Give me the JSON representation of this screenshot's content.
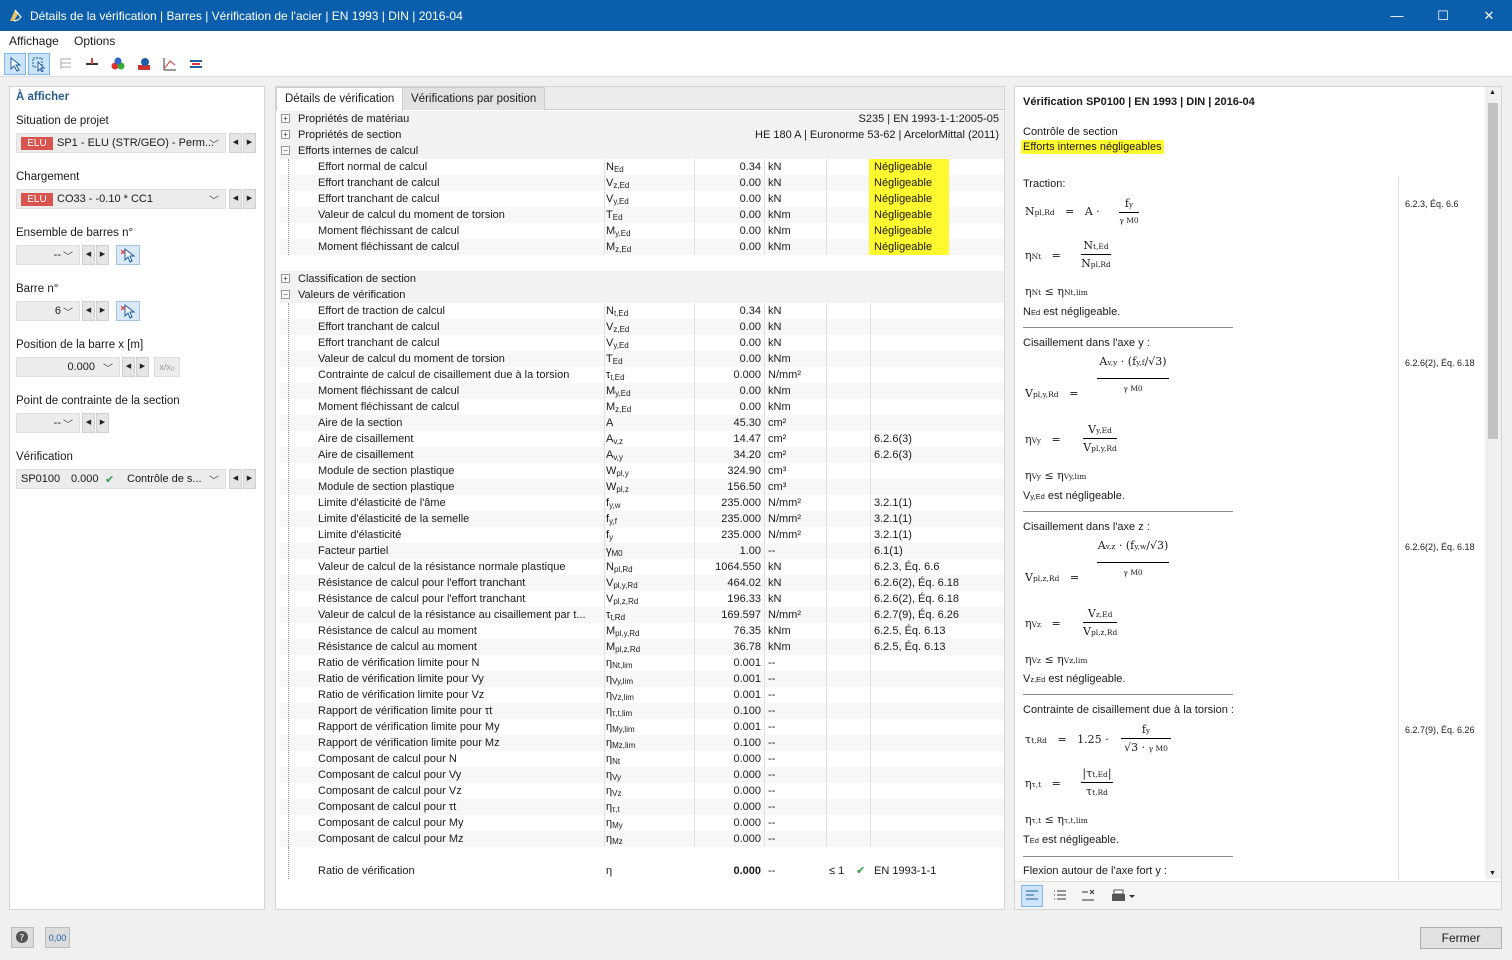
{
  "window": {
    "title": "Détails de la vérification | Barres | Vérification de l'acier | EN 1993 | DIN | 2016-04",
    "minimize": "—",
    "maximize": "☐",
    "close": "✕"
  },
  "menu": {
    "affichage": "Affichage",
    "options": "Options"
  },
  "left": {
    "header": "À afficher",
    "situation_label": "Situation de projet",
    "situation_badge": "ELU",
    "situation_value": "SP1 - ELU (STR/GEO) - Perm...",
    "chargement_label": "Chargement",
    "chargement_badge": "ELU",
    "chargement_value": "CO33 - -0.10 * CC1",
    "ensemble_label": "Ensemble de barres n°",
    "ensemble_value": "--",
    "barre_label": "Barre n°",
    "barre_value": "6",
    "position_label": "Position de la barre x [m]",
    "position_value": "0.000",
    "position_btn": "x/x₀",
    "point_label": "Point de contrainte de la section",
    "point_value": "--",
    "verif_label": "Vérification",
    "verif_id": "SP0100",
    "verif_ratio": "0.000",
    "verif_type": "Contrôle de s...",
    "left_arrow": "◀",
    "right_arrow": "▶"
  },
  "tabs": {
    "details": "Détails de vérification",
    "par_position": "Vérifications par position"
  },
  "groups": {
    "materiau": {
      "label": "Propriétés de matériau",
      "value": "S235 | EN 1993-1-1:2005-05"
    },
    "section": {
      "label": "Propriétés de section",
      "value": "HE 180 A | Euronorme 53-62 | ArcelorMittal (2011)"
    },
    "efforts": {
      "label": "Efforts internes de calcul"
    },
    "classification": {
      "label": "Classification de section"
    },
    "valeurs": {
      "label": "Valeurs de vérification"
    }
  },
  "efforts_rows": [
    {
      "name": "Effort normal de calcul",
      "sym": "NEd",
      "val": "0.34",
      "unit": "kN",
      "ref": "Négligeable"
    },
    {
      "name": "Effort tranchant de calcul",
      "sym": "Vz,Ed",
      "val": "0.00",
      "unit": "kN",
      "ref": "Négligeable"
    },
    {
      "name": "Effort tranchant de calcul",
      "sym": "Vy,Ed",
      "val": "0.00",
      "unit": "kN",
      "ref": "Négligeable"
    },
    {
      "name": "Valeur de calcul du moment de torsion",
      "sym": "TEd",
      "val": "0.00",
      "unit": "kNm",
      "ref": "Négligeable"
    },
    {
      "name": "Moment fléchissant de calcul",
      "sym": "My,Ed",
      "val": "0.00",
      "unit": "kNm",
      "ref": "Négligeable"
    },
    {
      "name": "Moment fléchissant de calcul",
      "sym": "Mz,Ed",
      "val": "0.00",
      "unit": "kNm",
      "ref": "Négligeable"
    }
  ],
  "valeurs_rows": [
    {
      "name": "Effort de traction de calcul",
      "sym": "Nt,Ed",
      "val": "0.34",
      "unit": "kN",
      "ref": ""
    },
    {
      "name": "Effort tranchant de calcul",
      "sym": "Vz,Ed",
      "val": "0.00",
      "unit": "kN",
      "ref": ""
    },
    {
      "name": "Effort tranchant de calcul",
      "sym": "Vy,Ed",
      "val": "0.00",
      "unit": "kN",
      "ref": ""
    },
    {
      "name": "Valeur de calcul du moment de torsion",
      "sym": "TEd",
      "val": "0.00",
      "unit": "kNm",
      "ref": ""
    },
    {
      "name": "Contrainte de calcul de cisaillement due à la torsion",
      "sym": "τt,Ed",
      "val": "0.000",
      "unit": "N/mm²",
      "ref": ""
    },
    {
      "name": "Moment fléchissant de calcul",
      "sym": "My,Ed",
      "val": "0.00",
      "unit": "kNm",
      "ref": ""
    },
    {
      "name": "Moment fléchissant de calcul",
      "sym": "Mz,Ed",
      "val": "0.00",
      "unit": "kNm",
      "ref": ""
    },
    {
      "name": "Aire de la section",
      "sym": "A",
      "val": "45.30",
      "unit": "cm²",
      "ref": ""
    },
    {
      "name": "Aire de cisaillement",
      "sym": "Av,z",
      "val": "14.47",
      "unit": "cm²",
      "ref": "6.2.6(3)"
    },
    {
      "name": "Aire de cisaillement",
      "sym": "Av,y",
      "val": "34.20",
      "unit": "cm²",
      "ref": "6.2.6(3)"
    },
    {
      "name": "Module de section plastique",
      "sym": "Wpl,y",
      "val": "324.90",
      "unit": "cm³",
      "ref": ""
    },
    {
      "name": "Module de section plastique",
      "sym": "Wpl,z",
      "val": "156.50",
      "unit": "cm³",
      "ref": ""
    },
    {
      "name": "Limite d'élasticité de l'âme",
      "sym": "fy,w",
      "val": "235.000",
      "unit": "N/mm²",
      "ref": "3.2.1(1)"
    },
    {
      "name": "Limite d'élasticité de la semelle",
      "sym": "fy,f",
      "val": "235.000",
      "unit": "N/mm²",
      "ref": "3.2.1(1)"
    },
    {
      "name": "Limite d'élasticité",
      "sym": "fy",
      "val": "235.000",
      "unit": "N/mm²",
      "ref": "3.2.1(1)"
    },
    {
      "name": "Facteur partiel",
      "sym": "γM0",
      "val": "1.00",
      "unit": "--",
      "ref": "6.1(1)"
    },
    {
      "name": "Valeur de calcul de la résistance normale plastique",
      "sym": "Npl,Rd",
      "val": "1064.550",
      "unit": "kN",
      "ref": "6.2.3, Éq. 6.6"
    },
    {
      "name": "Résistance de calcul pour l'effort tranchant",
      "sym": "Vpl,y,Rd",
      "val": "464.02",
      "unit": "kN",
      "ref": "6.2.6(2), Éq. 6.18"
    },
    {
      "name": "Résistance de calcul pour l'effort tranchant",
      "sym": "Vpl,z,Rd",
      "val": "196.33",
      "unit": "kN",
      "ref": "6.2.6(2), Éq. 6.18"
    },
    {
      "name": "Valeur de calcul de la résistance au cisaillement par t...",
      "sym": "τt,Rd",
      "val": "169.597",
      "unit": "N/mm²",
      "ref": "6.2.7(9), Éq. 6.26"
    },
    {
      "name": "Résistance de calcul au moment",
      "sym": "Mpl,y,Rd",
      "val": "76.35",
      "unit": "kNm",
      "ref": "6.2.5, Éq. 6.13"
    },
    {
      "name": "Résistance de calcul au moment",
      "sym": "Mpl,z,Rd",
      "val": "36.78",
      "unit": "kNm",
      "ref": "6.2.5, Éq. 6.13"
    },
    {
      "name": "Ratio de vérification limite pour N",
      "sym": "ηNt,lim",
      "val": "0.001",
      "unit": "--",
      "ref": ""
    },
    {
      "name": "Ratio de vérification limite pour Vy",
      "sym": "ηVy,lim",
      "val": "0.001",
      "unit": "--",
      "ref": ""
    },
    {
      "name": "Ratio de vérification limite pour Vz",
      "sym": "ηVz,lim",
      "val": "0.001",
      "unit": "--",
      "ref": ""
    },
    {
      "name": "Rapport de vérification limite pour τt",
      "sym": "ητ,t,lim",
      "val": "0.100",
      "unit": "--",
      "ref": ""
    },
    {
      "name": "Rapport de vérification limite pour My",
      "sym": "ηMy,lim",
      "val": "0.001",
      "unit": "--",
      "ref": ""
    },
    {
      "name": "Rapport de vérification limite pour Mz",
      "sym": "ηMz,lim",
      "val": "0.100",
      "unit": "--",
      "ref": ""
    },
    {
      "name": "Composant de calcul pour N",
      "sym": "ηNt",
      "val": "0.000",
      "unit": "--",
      "ref": ""
    },
    {
      "name": "Composant de calcul pour Vy",
      "sym": "ηVy",
      "val": "0.000",
      "unit": "--",
      "ref": ""
    },
    {
      "name": "Composant de calcul pour Vz",
      "sym": "ηVz",
      "val": "0.000",
      "unit": "--",
      "ref": ""
    },
    {
      "name": "Composant de calcul pour τt",
      "sym": "ητ,t",
      "val": "0.000",
      "unit": "--",
      "ref": ""
    },
    {
      "name": "Composant de calcul pour My",
      "sym": "ηMy",
      "val": "0.000",
      "unit": "--",
      "ref": ""
    },
    {
      "name": "Composant de calcul pour Mz",
      "sym": "ηMz",
      "val": "0.000",
      "unit": "--",
      "ref": ""
    }
  ],
  "ratio_row": {
    "name": "Ratio de vérification",
    "sym": "η",
    "val": "0.000",
    "unit": "--",
    "le": "≤ 1",
    "ck": "✔",
    "ref": "EN 1993-1-1"
  },
  "right": {
    "title": "Vérification SP0100 | EN 1993 | DIN | 2016-04",
    "controle": "Contrôle de section",
    "efforts_neg": "Efforts internes négligeables",
    "traction": "Traction:",
    "traction_ref": "6.2.3, Éq. 6.6",
    "ned_neg": "est négligeable.",
    "cis_y": "Cisaillement dans l'axe y :",
    "cis_y_ref": "6.2.6(2), Éq. 6.18",
    "vy_neg": "est négligeable.",
    "cis_z": "Cisaillement dans l'axe z :",
    "cis_z_ref": "6.2.6(2), Éq. 6.18",
    "vz_neg": "est négligeable.",
    "torsion": "Contrainte de cisaillement due à la torsion :",
    "torsion_ref": "6.2.7(9), Éq. 6.26",
    "ted_neg": "est négligeable.",
    "flexion": "Flexion autour de l'axe fort y :",
    "coef": "1.25"
  },
  "bottom": {
    "close": "Fermer",
    "zero_btn": "0,00"
  },
  "colors": {
    "titlebar": "#0a5eab",
    "highlight": "#fff82f",
    "elu_badge": "#d9534f",
    "check": "#2e9e44"
  }
}
